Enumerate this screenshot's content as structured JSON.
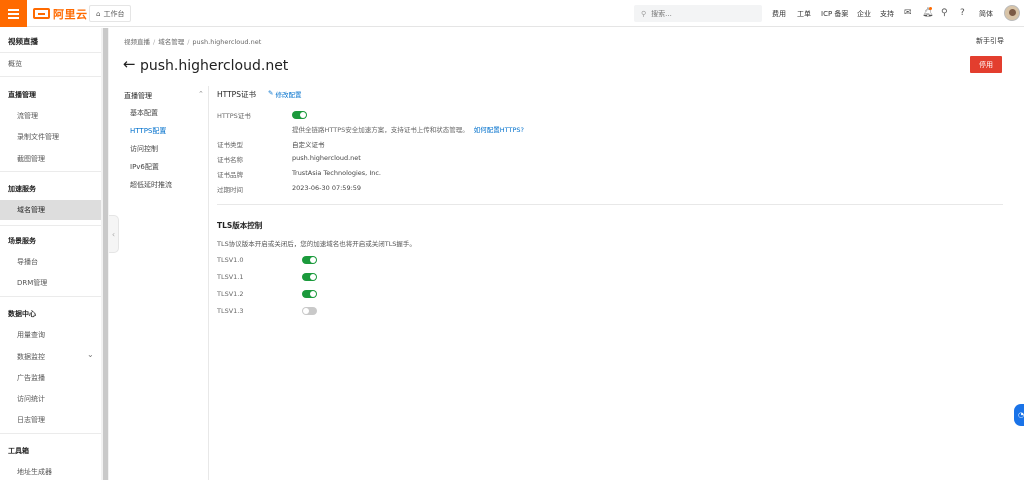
{
  "topbar": {
    "logo_text": "阿里云",
    "workbench": "工作台",
    "search_placeholder": "搜索...",
    "nav": [
      "费用",
      "工单",
      "ICP 备案",
      "企业",
      "支持"
    ],
    "lang": "简体"
  },
  "sidebar": {
    "title": "视频直播",
    "overview": "概览",
    "groups": [
      {
        "label": "直播管理",
        "items": [
          "流管理",
          "录制文件管理",
          "截图管理"
        ]
      },
      {
        "label": "加速服务",
        "items": [
          "域名管理"
        ]
      },
      {
        "label": "场景服务",
        "items": [
          "导播台",
          "DRM管理"
        ]
      },
      {
        "label": "数据中心",
        "items": [
          "用量查询",
          "数据监控",
          "广告监播",
          "访问统计",
          "日志管理"
        ]
      },
      {
        "label": "工具箱",
        "items": [
          "地址生成器"
        ]
      }
    ]
  },
  "breadcrumb": [
    "视频直播",
    "域名管理",
    "push.highercloud.net"
  ],
  "guide": "新手引导",
  "page_title": "push.highercloud.net",
  "stop_button": "停用",
  "subnav": {
    "head": "直播管理",
    "items": [
      "基本配置",
      "HTTPS配置",
      "访问控制",
      "IPv6配置",
      "超低延时推流"
    ]
  },
  "https": {
    "section_title": "HTTPS证书",
    "edit_label": "修改配置",
    "cert_label": "HTTPS证书",
    "cert_enabled": true,
    "desc": "提供全链路HTTPS安全加速方案，支持证书上传和状态管理。",
    "desc_link": "如何配置HTTPS?",
    "rows": [
      {
        "label": "证书类型",
        "value": "自定义证书"
      },
      {
        "label": "证书名称",
        "value": "push.highercloud.net"
      },
      {
        "label": "证书品牌",
        "value": "TrustAsia Technologies, Inc."
      },
      {
        "label": "过期时间",
        "value": "2023-06-30 07:59:59"
      }
    ]
  },
  "tls": {
    "title": "TLS版本控制",
    "desc": "TLS协议版本开启或关闭后，您的加速域名也将开启或关闭TLS握手。",
    "versions": [
      {
        "label": "TLSV1.0",
        "enabled": true
      },
      {
        "label": "TLSV1.1",
        "enabled": true
      },
      {
        "label": "TLSV1.2",
        "enabled": true
      },
      {
        "label": "TLSV1.3",
        "enabled": false
      }
    ]
  }
}
